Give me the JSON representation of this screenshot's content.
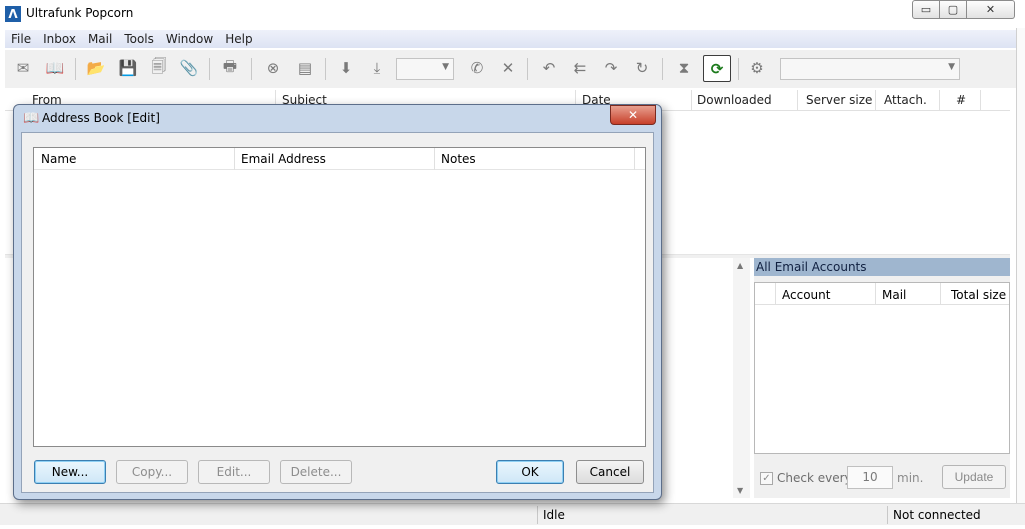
{
  "window": {
    "title": "Ultrafunk Popcorn",
    "logo_glyph": "Λ",
    "controls": {
      "minimize": "▭",
      "maximize": "▢",
      "close": "✕"
    }
  },
  "menu": {
    "items": [
      "File",
      "Inbox",
      "Mail",
      "Tools",
      "Window",
      "Help"
    ]
  },
  "toolbar": {
    "icons": [
      "new-mail-icon",
      "address-book-icon",
      "open-folder-icon",
      "save-icon",
      "save-all-icon",
      "attachment-icon",
      "print-icon",
      "cancel-icon",
      "document-icon",
      "download-icon",
      "download-selected-icon",
      "mailbox-icon",
      "delete-icon",
      "reply-icon",
      "reply-all-icon",
      "forward-icon",
      "redirect-icon",
      "hourglass-icon",
      "check-mail-icon",
      "settings-icon"
    ],
    "glyphs": {
      "new_mail": "✉",
      "address_book": "📖",
      "open_folder": "📂",
      "save": "💾",
      "save_all": "🗐",
      "attachment": "📎",
      "print": "🖶",
      "cancel": "⊗",
      "document": "▤",
      "download": "⬇",
      "download_selected": "⤓",
      "mailbox": "✆",
      "delete": "✕",
      "reply": "↶",
      "reply_all": "⇇",
      "forward": "↷",
      "redirect": "↻",
      "hourglass": "⧗",
      "check_mail": "⟳",
      "settings": "⚙"
    }
  },
  "message_list": {
    "columns": [
      "From",
      "Subject",
      "Date",
      "Downloaded",
      "Server size",
      "Attach.",
      "#"
    ]
  },
  "accounts": {
    "title": "All Email Accounts",
    "columns": [
      "Account",
      "Mail",
      "Total size"
    ],
    "check_label": "Check every",
    "check_checked": true,
    "check_glyph": "✓",
    "interval": "10",
    "interval_unit": "min.",
    "update_label": "Update"
  },
  "status": {
    "left": "Idle",
    "right": "Not connected"
  },
  "dialog": {
    "title": "Address Book [Edit]",
    "close_glyph": "✕",
    "columns": [
      "Name",
      "Email Address",
      "Notes"
    ],
    "buttons": {
      "new": "New...",
      "copy": "Copy...",
      "edit": "Edit...",
      "delete": "Delete...",
      "ok": "OK",
      "cancel": "Cancel"
    }
  },
  "colors": {
    "accent": "#1f5fa8",
    "accounts_header": "#9fb6cf",
    "dialog_frame": "#c8d7ea",
    "close_button": "#c7402a"
  }
}
